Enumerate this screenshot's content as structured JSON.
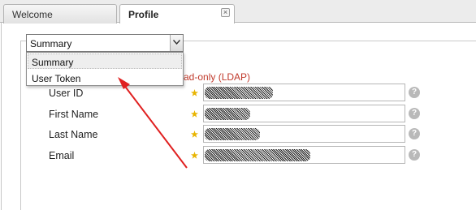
{
  "tabs": [
    {
      "label": "Welcome",
      "active": false
    },
    {
      "label": "Profile",
      "active": true,
      "closable": true
    }
  ],
  "view_select": {
    "value": "Summary",
    "options": [
      "Summary",
      "User Token"
    ],
    "highlighted": "Summary"
  },
  "ldap_note": "ad-only (LDAP)",
  "fields": [
    {
      "label": "User ID",
      "required_icon": "star-icon",
      "value_obscured": true
    },
    {
      "label": "First Name",
      "required_icon": "star-icon",
      "value_obscured": true
    },
    {
      "label": "Last Name",
      "required_icon": "star-icon",
      "value_obscured": true
    },
    {
      "label": "Email",
      "required_icon": "star-icon",
      "value_obscured": true
    }
  ],
  "help_glyph": "?",
  "close_glyph": "×",
  "colors": {
    "annotation_arrow": "#e02020",
    "ldap_note": "#c0392b",
    "required_star": "#e8b400"
  }
}
